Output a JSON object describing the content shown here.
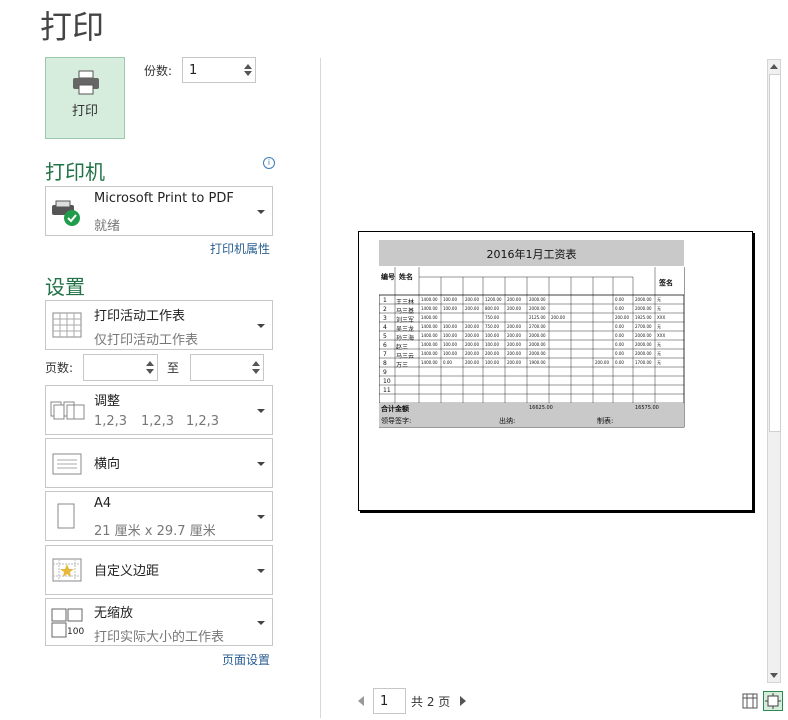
{
  "page_title": "打印",
  "print_button_label": "打印",
  "copies": {
    "label": "份数:",
    "value": "1"
  },
  "printer_section": {
    "heading": "打印机",
    "info_glyph": "i",
    "printer_name": "Microsoft Print to PDF",
    "printer_status": "就绪",
    "properties_link": "打印机属性"
  },
  "settings_section": {
    "heading": "设置",
    "scope": {
      "main": "打印活动工作表",
      "sub": "仅打印活动工作表"
    },
    "pages": {
      "label": "页数:",
      "to_label": "至",
      "from_value": "",
      "to_value": ""
    },
    "collate": {
      "main": "调整",
      "sub": [
        "1,2,3",
        "1,2,3",
        "1,2,3"
      ]
    },
    "orientation": {
      "main": "横向"
    },
    "paper": {
      "main": "A4",
      "sub": "21 厘米 x 29.7 厘米"
    },
    "margins": {
      "main": "自定义边距"
    },
    "scaling": {
      "main": "无缩放",
      "sub": "打印实际大小的工作表",
      "icon_text": "100"
    },
    "page_setup_link": "页面设置"
  },
  "preview": {
    "sheet_title": "2016年1月工资表",
    "col_headers": [
      "编号",
      "姓名",
      "",
      "",
      "",
      "",
      "",
      "",
      "",
      "",
      "",
      "",
      "",
      "",
      "签名"
    ],
    "rows": [
      [
        "1",
        "王三林",
        "1400.00",
        "100.00",
        "200.00",
        "1200.00",
        "200.00",
        "2000.00",
        "",
        "",
        "",
        "0.00",
        "2000.00",
        "无"
      ],
      [
        "2",
        "马三基",
        "1400.00",
        "100.00",
        "200.00",
        "800.00",
        "200.00",
        "2000.00",
        "",
        "",
        "",
        "0.00",
        "2000.00",
        "无"
      ],
      [
        "3",
        "刘三军",
        "1400.00",
        "",
        "",
        "750.00",
        "",
        "2125.00",
        "200.00",
        "",
        "",
        "200.00",
        "1925.00",
        "XXX"
      ],
      [
        "4",
        "吴三龙",
        "1400.00",
        "100.00",
        "200.00",
        "750.00",
        "200.00",
        "2700.00",
        "",
        "",
        "",
        "0.00",
        "2700.00",
        "无"
      ],
      [
        "5",
        "孙三海",
        "1400.00",
        "100.00",
        "200.00",
        "100.00",
        "200.00",
        "2000.00",
        "",
        "",
        "",
        "0.00",
        "2000.00",
        "XXX"
      ],
      [
        "6",
        "赵三",
        "1400.00",
        "100.00",
        "200.00",
        "100.00",
        "200.00",
        "2000.00",
        "",
        "",
        "",
        "0.00",
        "2000.00",
        "无"
      ],
      [
        "7",
        "马三云",
        "1400.00",
        "100.00",
        "200.00",
        "200.00",
        "200.00",
        "2000.00",
        "",
        "",
        "",
        "0.00",
        "2000.00",
        "无"
      ],
      [
        "8",
        "万三",
        "1400.00",
        "0.00",
        "200.00",
        "100.00",
        "200.00",
        "1900.00",
        "",
        "",
        "200.00",
        "0.00",
        "1700.00",
        "无"
      ],
      [
        "9",
        "",
        "",
        "",
        "",
        "",
        "",
        "",
        "",
        "",
        "",
        "",
        "",
        ""
      ],
      [
        "10",
        "",
        "",
        "",
        "",
        "",
        "",
        "",
        "",
        "",
        "",
        "",
        "",
        ""
      ],
      [
        "11",
        "",
        "",
        "",
        "",
        "",
        "",
        "",
        "",
        "",
        "",
        "",
        "",
        ""
      ]
    ],
    "total_row": [
      "合计金额",
      "",
      "",
      "",
      "",
      "",
      "16625.00",
      "",
      "",
      "",
      "",
      "16575.00",
      ""
    ],
    "footer": {
      "signature": "领导签字:",
      "cashier": "出纳:",
      "maker": "制表:"
    }
  },
  "pager": {
    "current": "1",
    "total_text": "共 2 页"
  },
  "colors": {
    "accent": "#217346",
    "link": "#2b5e91",
    "print_button_bg": "#d6ecdd"
  }
}
